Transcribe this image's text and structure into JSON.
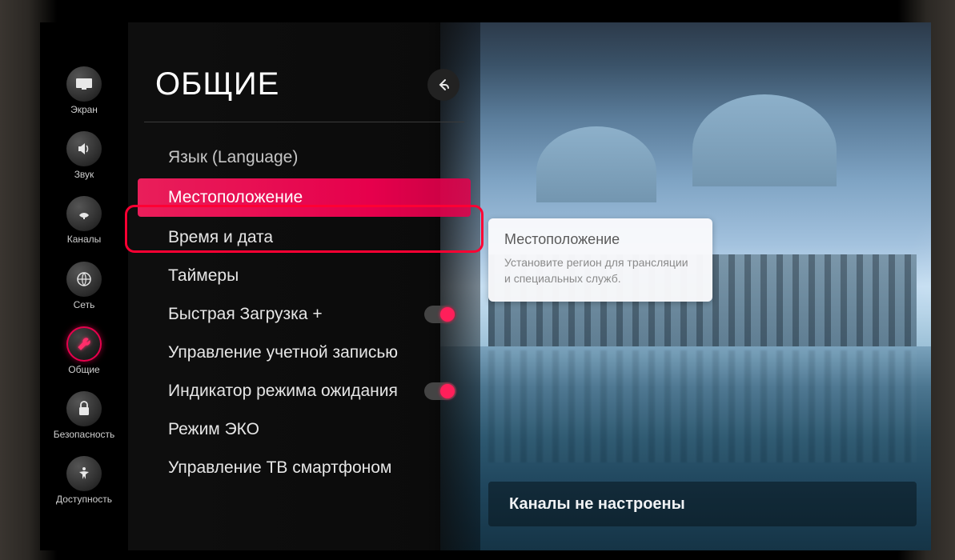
{
  "sidebar": {
    "items": [
      {
        "label": "Экран"
      },
      {
        "label": "Звук"
      },
      {
        "label": "Каналы"
      },
      {
        "label": "Сеть"
      },
      {
        "label": "Общие"
      },
      {
        "label": "Безопасность"
      },
      {
        "label": "Доступность"
      }
    ]
  },
  "panel": {
    "title": "ОБЩИЕ"
  },
  "menu": {
    "items": [
      {
        "label": "Язык (Language)"
      },
      {
        "label": "Местоположение"
      },
      {
        "label": "Время и дата"
      },
      {
        "label": "Таймеры"
      },
      {
        "label": "Быстрая Загрузка +"
      },
      {
        "label": "Управление учетной записью"
      },
      {
        "label": "Индикатор режима ожидания"
      },
      {
        "label": "Режим ЭКО"
      },
      {
        "label": "Управление ТВ смартфоном"
      }
    ]
  },
  "tooltip": {
    "title": "Местоположение",
    "desc": "Установите регион для трансляции и специальных служб."
  },
  "bottom": {
    "text": "Каналы не настроены"
  }
}
